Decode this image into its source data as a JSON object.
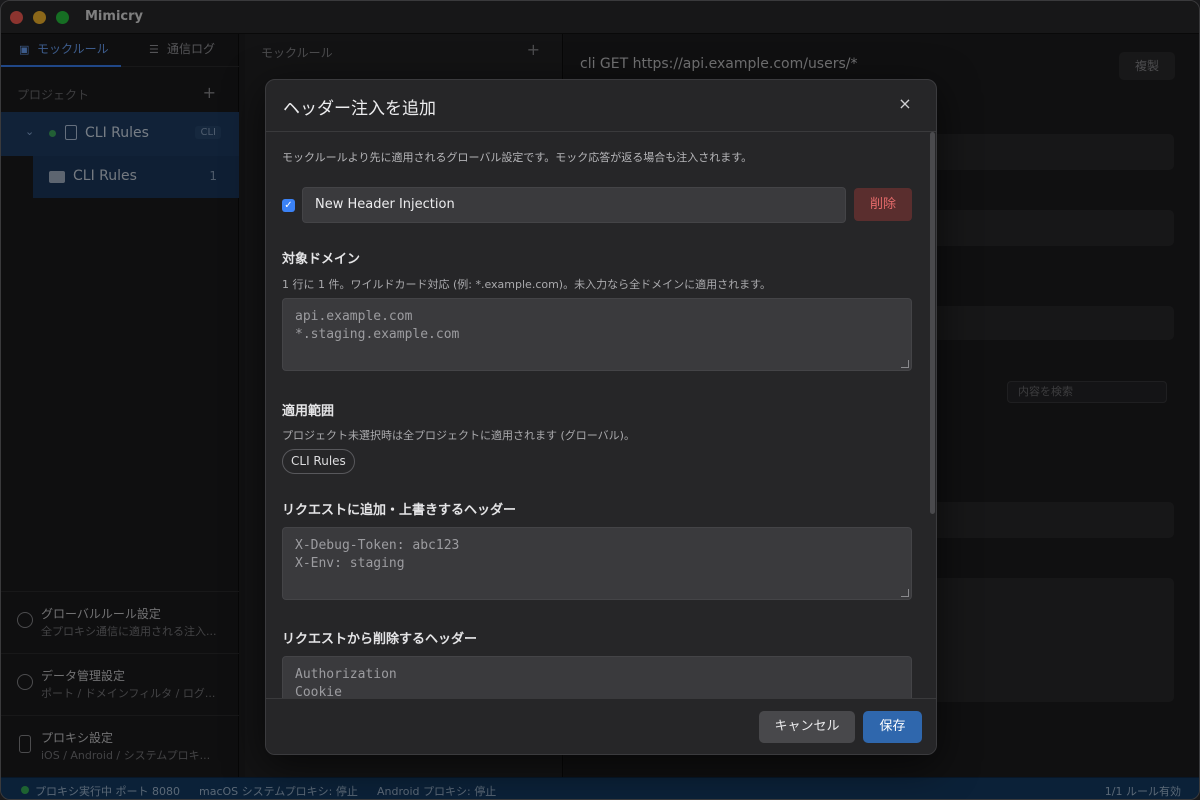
{
  "app": {
    "title": "Mimicry"
  },
  "sidebar": {
    "tabs": [
      {
        "label": "モックルール",
        "icon": "rules-icon"
      },
      {
        "label": "通信ログ",
        "icon": "log-icon"
      }
    ],
    "project_header": "プロジェクト",
    "add_symbol": "+",
    "tree": {
      "project": {
        "label": "CLI Rules",
        "badge": "CLI",
        "chevron": "⌄"
      },
      "folder": {
        "label": "CLI Rules",
        "count": "1"
      }
    },
    "footer": [
      {
        "title": "グローバルルール設定",
        "subtitle": "全プロキシ通信に適用される注入...",
        "icon": "globe-icon"
      },
      {
        "title": "データ管理設定",
        "subtitle": "ポート / ドメインフィルタ / ログ...",
        "icon": "gear-icon"
      },
      {
        "title": "プロキシ設定",
        "subtitle": "iOS / Android / システムプロキ...",
        "icon": "phone-icon"
      }
    ]
  },
  "middle": {
    "title": "モックルール",
    "add_symbol": "+"
  },
  "right": {
    "url": "cli GET https://api.example.com/users/*",
    "button_label": "複製",
    "search_placeholder": "内容を検索"
  },
  "modal": {
    "title": "ヘッダー注入を追加",
    "close_symbol": "×",
    "description": "モックルールより先に適用されるグローバル設定です。モック応答が返る場合も注入されます。",
    "enabled": true,
    "name_value": "New Header Injection",
    "delete_label": "削除",
    "domain": {
      "title": "対象ドメイン",
      "hint": "1 行に 1 件。ワイルドカード対応 (例: *.example.com)。未入力なら全ドメインに適用されます。",
      "lines": [
        "api.example.com",
        "*.staging.example.com"
      ]
    },
    "scope": {
      "title": "適用範囲",
      "hint": "プロジェクト未選択時は全プロジェクトに適用されます (グローバル)。",
      "chip": "CLI Rules"
    },
    "add_headers": {
      "title": "リクエストに追加・上書きするヘッダー",
      "lines": [
        "X-Debug-Token: abc123",
        "X-Env: staging"
      ]
    },
    "remove_headers": {
      "title": "リクエストから削除するヘッダー",
      "lines": [
        "Authorization",
        "Cookie"
      ]
    },
    "cancel_label": "キャンセル",
    "save_label": "保存"
  },
  "statusbar": {
    "proxy": "プロキシ実行中 ポート 8080",
    "macos": "macOS システムプロキシ: 停止",
    "android": "Android プロキシ: 停止",
    "rules": "1/1 ルール有効"
  },
  "colors": {
    "accent": "#3b82f6",
    "save": "#2f67ad",
    "danger": "#e46a6a",
    "status_ok": "#37b45a"
  }
}
